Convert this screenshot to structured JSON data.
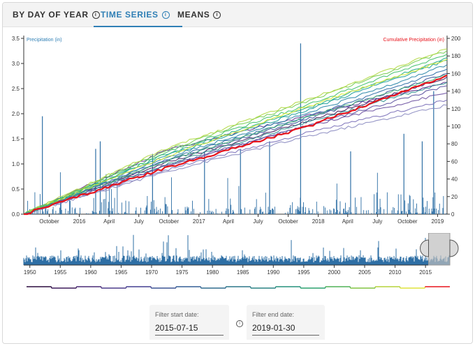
{
  "tabs": [
    {
      "label": "BY DAY OF YEAR",
      "active": false
    },
    {
      "label": "TIME SERIES",
      "active": true
    },
    {
      "label": "MEANS",
      "active": false
    }
  ],
  "info_glyph": "i",
  "colors": {
    "accent": "#2f7fb5",
    "precip": "#2e6fa5",
    "highlight": "#e8141c"
  },
  "chart_data": [
    {
      "type": "line",
      "left_axis_label": "Precipitation (in)",
      "right_axis_label": "Cumulative Precipitation (in)",
      "left_ticks": [
        "0.0",
        "0.5",
        "1.0",
        "1.5",
        "2.0",
        "2.5",
        "3.0",
        "3.5"
      ],
      "left_ylim": [
        0,
        3.5
      ],
      "right_ticks": [
        "0",
        "20",
        "40",
        "60",
        "80",
        "100",
        "120",
        "140",
        "160",
        "180",
        "200"
      ],
      "right_ylim": [
        0,
        200
      ],
      "x_ticks": [
        "October",
        "2016",
        "April",
        "July",
        "October",
        "2017",
        "April",
        "July",
        "October",
        "2018",
        "April",
        "July",
        "October",
        "2019"
      ],
      "x_range": [
        "2015-07-15",
        "2019-01-30"
      ],
      "notable_daily_precip": [
        {
          "date": "2015-09-10",
          "value": 1.95
        },
        {
          "date": "2016-02-20",
          "value": 1.3
        },
        {
          "date": "2016-03-05",
          "value": 1.45
        },
        {
          "date": "2016-08-12",
          "value": 1.2
        },
        {
          "date": "2017-01-18",
          "value": 1.25
        },
        {
          "date": "2017-05-08",
          "value": 1.3
        },
        {
          "date": "2017-08-05",
          "value": 1.45
        },
        {
          "date": "2017-11-08",
          "value": 3.4
        },
        {
          "date": "2018-04-10",
          "value": 1.25
        },
        {
          "date": "2018-09-20",
          "value": 1.6
        },
        {
          "date": "2018-11-15",
          "value": 1.45
        },
        {
          "date": "2018-12-20",
          "value": 2.45
        }
      ],
      "cumulative_series": [
        {
          "highlight": true,
          "color": "#e8141c",
          "values": [
            0,
            52,
            99,
            158
          ]
        },
        {
          "color": "#3d1a5a",
          "values": [
            0,
            58,
            105,
            156
          ]
        },
        {
          "color": "#5b2d8c",
          "values": [
            0,
            72,
            112,
            150
          ]
        },
        {
          "color": "#6a4fa0",
          "values": [
            0,
            55,
            100,
            138
          ]
        },
        {
          "color": "#7a6fb8",
          "values": [
            0,
            50,
            92,
            130
          ]
        },
        {
          "color": "#8a8ac0",
          "values": [
            0,
            48,
            88,
            124
          ]
        },
        {
          "color": "#3a4f9a",
          "values": [
            0,
            60,
            108,
            160
          ]
        },
        {
          "color": "#2e6aa5",
          "values": [
            0,
            62,
            110,
            165
          ]
        },
        {
          "color": "#2a86a8",
          "values": [
            0,
            64,
            114,
            170
          ]
        },
        {
          "color": "#1f9e9a",
          "values": [
            0,
            66,
            118,
            175
          ]
        },
        {
          "color": "#25ad82",
          "values": [
            0,
            68,
            120,
            178
          ]
        },
        {
          "color": "#3fbf6a",
          "values": [
            0,
            70,
            124,
            182
          ]
        },
        {
          "color": "#74cc50",
          "values": [
            0,
            72,
            128,
            186
          ]
        },
        {
          "color": "#b0d840",
          "values": [
            0,
            74,
            130,
            188
          ]
        },
        {
          "color": "#d8e830",
          "values": [
            0,
            65,
            122,
            176
          ]
        },
        {
          "color": "#2c8f8f",
          "values": [
            0,
            56,
            104,
            150
          ]
        },
        {
          "color": "#4ab47a",
          "values": [
            0,
            60,
            110,
            158
          ]
        },
        {
          "color": "#5a4f9e",
          "values": [
            0,
            54,
            100,
            146
          ]
        }
      ]
    },
    {
      "type": "bar",
      "role": "overview",
      "x_ticks": [
        "1950",
        "1955",
        "1960",
        "1965",
        "1970",
        "1975",
        "1980",
        "1985",
        "1990",
        "1995",
        "2000",
        "2005",
        "2010",
        "2015"
      ],
      "year_range": [
        1949,
        2019
      ],
      "brush_range": [
        "2015-07-15",
        "2019-01-30"
      ]
    },
    {
      "type": "line",
      "role": "year-legend",
      "colors": [
        "#2b0b3f",
        "#3d1a5a",
        "#4a2a76",
        "#4b3a8a",
        "#443f91",
        "#3b5394",
        "#335f95",
        "#2e6b8e",
        "#2b7689",
        "#288284",
        "#25917c",
        "#2aa06f",
        "#4eb257",
        "#82c441",
        "#b6d43a",
        "#dfe43a",
        "#e8141c"
      ]
    }
  ],
  "filters": {
    "start_label": "Filter start date:",
    "start_value": "2015-07-15",
    "end_label": "Filter end date:",
    "end_value": "2019-01-30"
  }
}
